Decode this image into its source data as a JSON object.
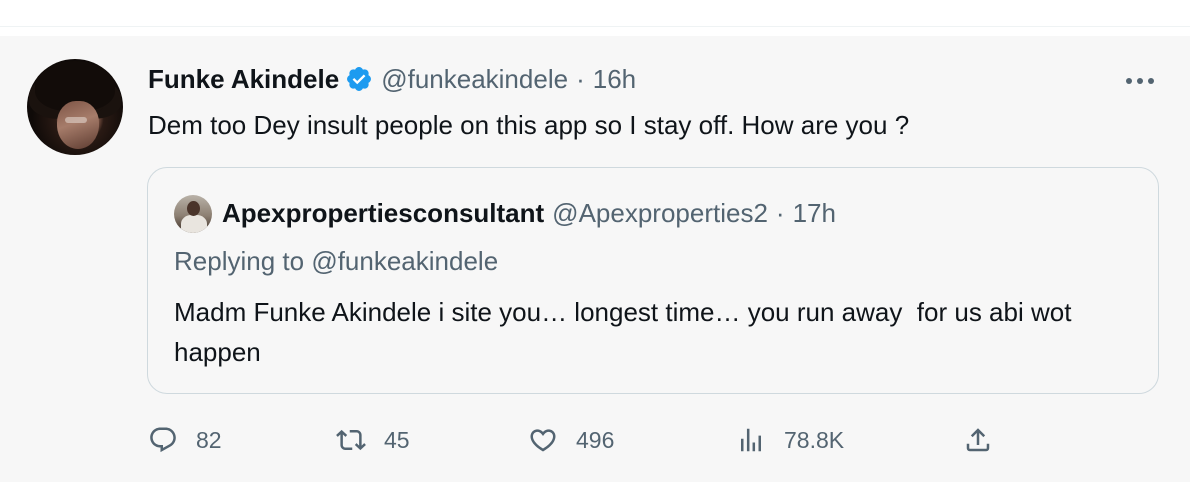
{
  "tweet": {
    "display_name": "Funke Akindele",
    "handle": "@funkeakindele",
    "separator": "·",
    "time": "16h",
    "text": "Dem too Dey insult people on this app so I stay off. How are you ?",
    "avatar_icon": "profile-photo",
    "verified_icon": "verified-badge-icon",
    "verified_color": "#1d9bf0"
  },
  "quote": {
    "display_name": "Apexpropertiesconsultant",
    "handle": "@Apexproperties2",
    "separator": "·",
    "time": "17h",
    "replying_prefix": "Replying to",
    "replying_handle": "@funkeakindele",
    "text": "Madm Funke Akindele i site you… longest time… you run away  for us abi wot happen"
  },
  "actions": {
    "reply_count": "82",
    "retweet_count": "45",
    "like_count": "496",
    "views_count": "78.8K"
  },
  "colors": {
    "background": "#f7f7f7",
    "text_primary": "#0f1419",
    "text_secondary": "#536471",
    "border": "#cfd9de",
    "accent": "#1d9bf0"
  }
}
